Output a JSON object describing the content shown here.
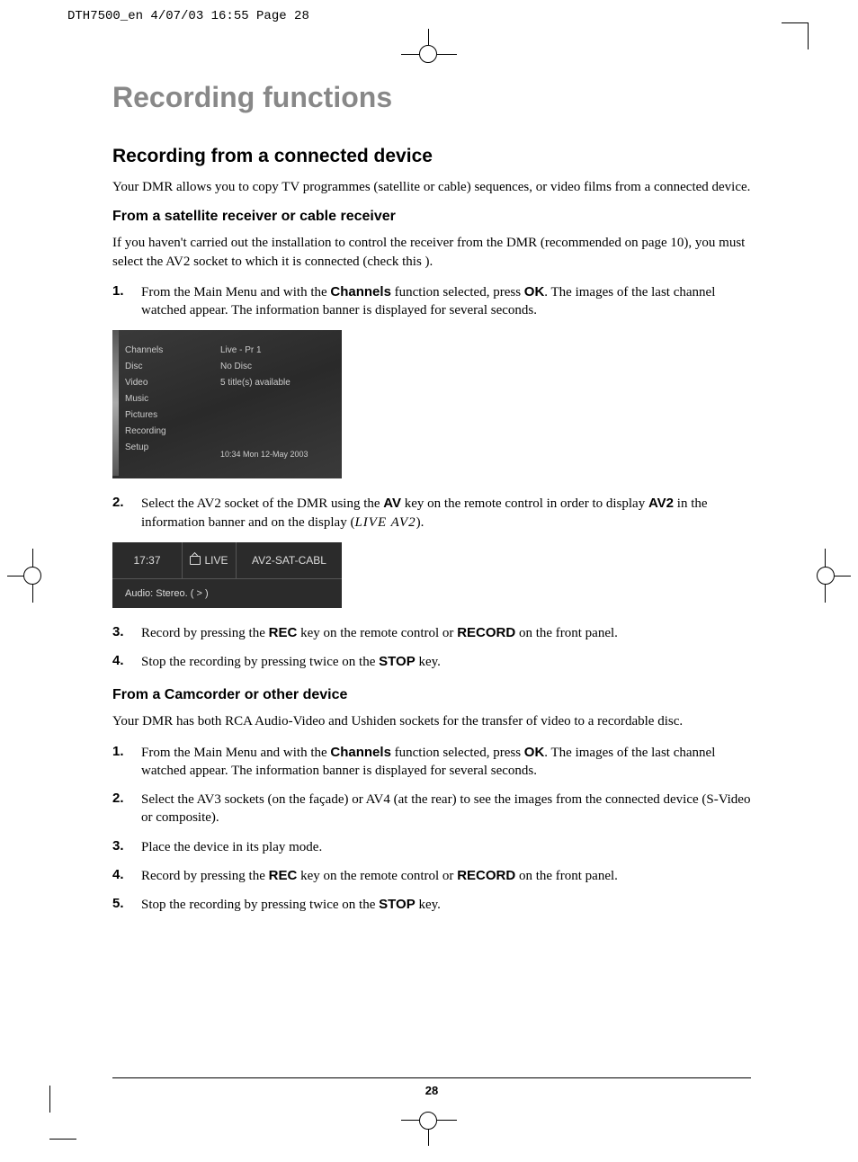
{
  "slug": "DTH7500_en  4/07/03  16:55  Page 28",
  "chapter_title": "Recording functions",
  "section_title": "Recording from a connected device",
  "intro": "Your DMR allows you to copy TV programmes (satellite or cable) sequences, or video films from a connected device.",
  "sectionA": {
    "heading": "From a satellite receiver or cable receiver",
    "lead": "If you haven't carried out the installation to control the receiver from the DMR (recommended on page 10), you must select the AV2 socket to which it is connected (check this ).",
    "step1_num": "1.",
    "step1_a": "From the Main Menu and with the ",
    "step1_b1": "Channels",
    "step1_c": " function selected, press ",
    "step1_b2": "OK",
    "step1_d": ". The images of the last channel watched appear. The information banner is displayed for several seconds.",
    "step2_num": "2.",
    "step2_a": "Select the AV2 socket of the DMR using the ",
    "step2_b1": "AV",
    "step2_c": " key on the remote control in order to display ",
    "step2_b2": "AV2",
    "step2_d": " in the information banner and on the display (",
    "step2_lcd": "LIVE AV2",
    "step2_e": ").",
    "step3_num": "3.",
    "step3_a": "Record by pressing the ",
    "step3_b1": "REC",
    "step3_c": " key on the remote control or ",
    "step3_b2": "RECORD",
    "step3_d": " on the front panel.",
    "step4_num": "4.",
    "step4_a": "Stop the recording by pressing twice on the ",
    "step4_b1": "STOP",
    "step4_c": " key."
  },
  "menu": {
    "left": [
      "Channels",
      "Disc",
      "Video",
      "Music",
      "Pictures",
      "Recording",
      "Setup"
    ],
    "right": [
      "Live - Pr 1",
      "No Disc",
      "5 title(s) available"
    ],
    "time": "10:34 Mon 12-May 2003"
  },
  "banner": {
    "time": "17:37",
    "live": "LIVE",
    "source": "AV2-SAT-CABL",
    "audio": "Audio: Stereo.  ( > )"
  },
  "sectionB": {
    "heading": "From a Camcorder or other device",
    "lead": "Your DMR has both RCA Audio-Video and Ushiden sockets for the transfer of video to a recordable disc.",
    "step1_num": "1.",
    "step1_a": "From the Main Menu and with the ",
    "step1_b1": "Channels",
    "step1_c": " function selected, press ",
    "step1_b2": "OK",
    "step1_d": ". The images of the last channel watched appear. The information banner is displayed for several seconds.",
    "step2_num": "2.",
    "step2_txt": "Select the AV3 sockets (on the façade) or AV4 (at the rear) to see the images from the connected device (S-Video or composite).",
    "step3_num": "3.",
    "step3_txt": "Place the device in its play mode.",
    "step4_num": "4.",
    "step4_a": "Record by pressing the ",
    "step4_b1": "REC",
    "step4_c": " key on the remote control or ",
    "step4_b2": "RECORD",
    "step4_d": " on the front panel.",
    "step5_num": "5.",
    "step5_a": "Stop the recording by pressing twice on the ",
    "step5_b1": "STOP",
    "step5_c": " key."
  },
  "page_number": "28"
}
